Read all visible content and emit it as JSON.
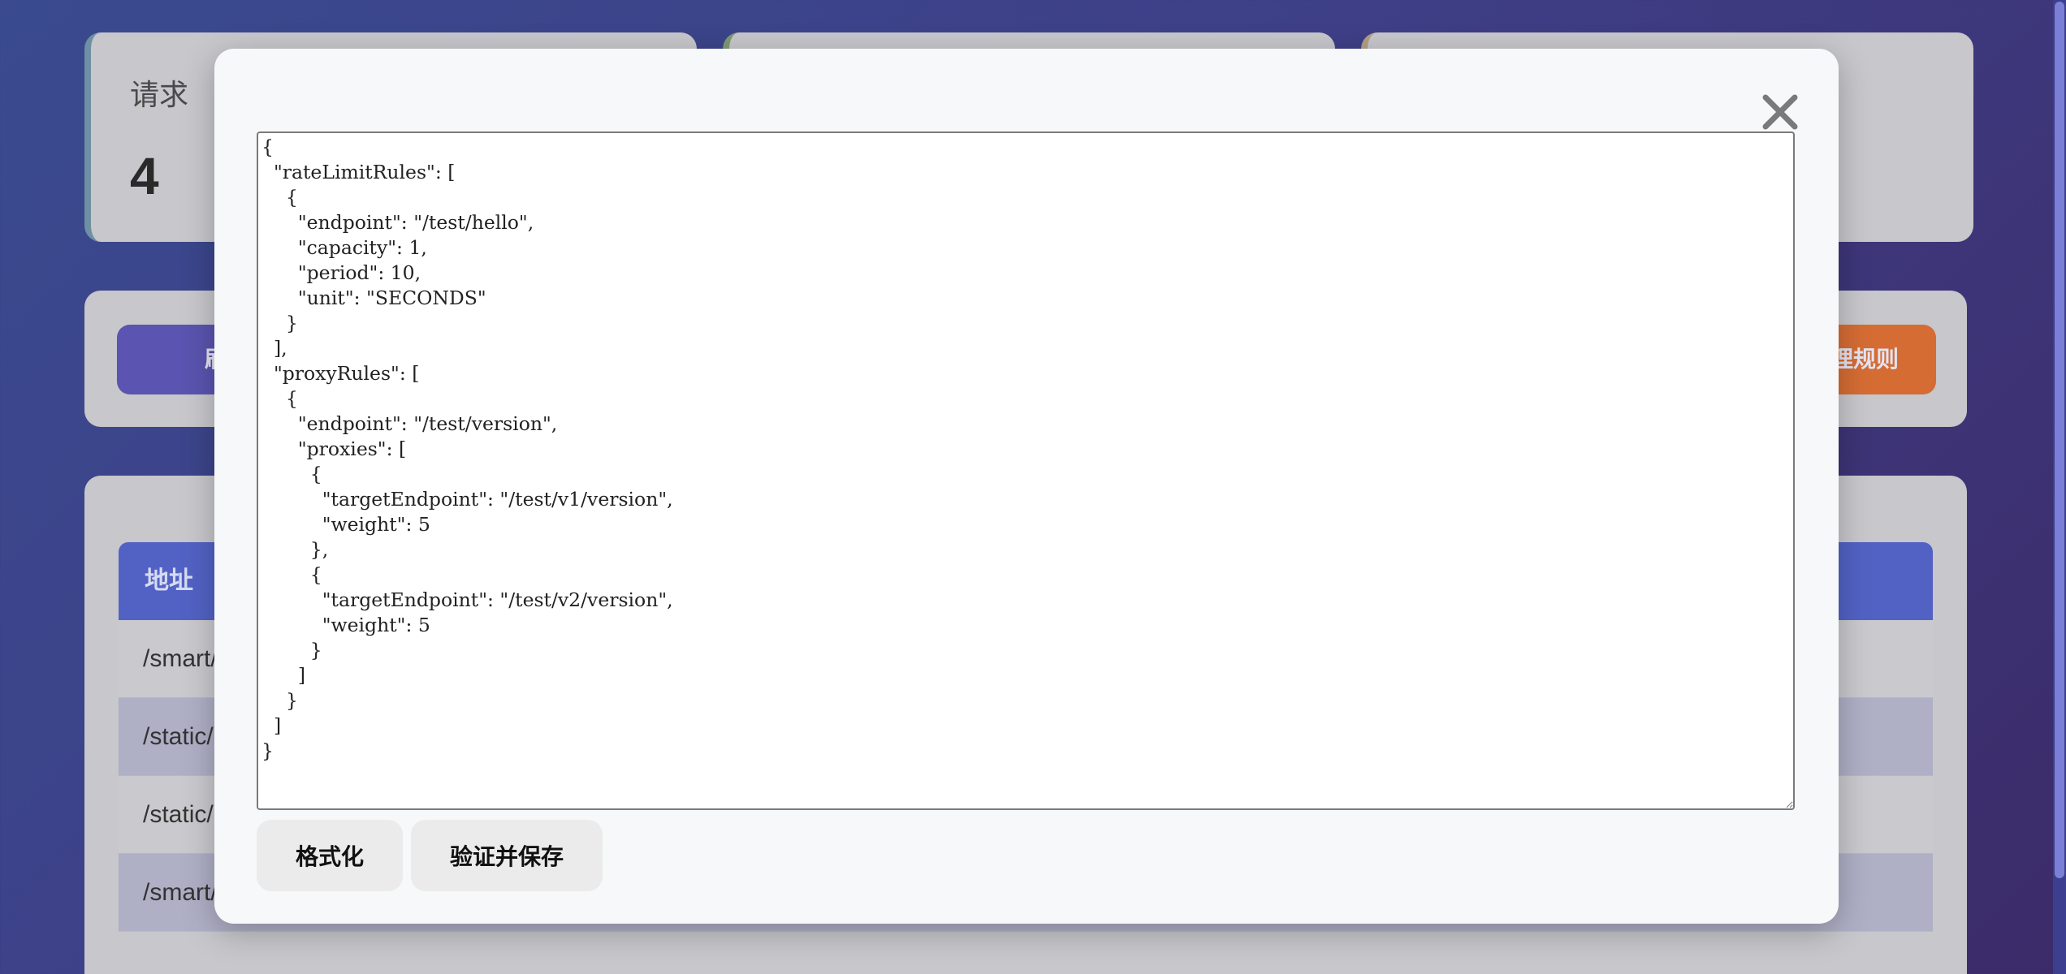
{
  "stats": {
    "card1": {
      "label": "请求",
      "value": "4"
    }
  },
  "toolbar": {
    "refresh_label": "刷新数",
    "proxy_label": "理规则"
  },
  "table": {
    "header": "地址",
    "rows": [
      "/smart/",
      "/static/",
      "/static/",
      "/smart/"
    ]
  },
  "modal": {
    "close_icon": "close-icon",
    "editor_content": "{\n  \"rateLimitRules\": [\n    {\n      \"endpoint\": \"/test/hello\",\n      \"capacity\": 1,\n      \"period\": 10,\n      \"unit\": \"SECONDS\"\n    }\n  ],\n  \"proxyRules\": [\n    {\n      \"endpoint\": \"/test/version\",\n      \"proxies\": [\n        {\n          \"targetEndpoint\": \"/test/v1/version\",\n          \"weight\": 5\n        },\n        {\n          \"targetEndpoint\": \"/test/v2/version\",\n          \"weight\": 5\n        }\n      ]\n    }\n  ]\n}",
    "format_label": "格式化",
    "save_label": "验证并保存"
  },
  "colors": {
    "modal_bg": "#f7f8f9",
    "refresh_button": "#5b54b0",
    "proxy_button": "#d56c34",
    "table_header": "#5262c4"
  }
}
